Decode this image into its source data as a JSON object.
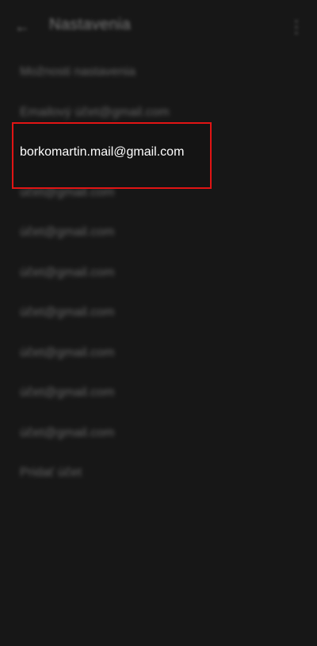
{
  "header": {
    "back_icon": "arrow-left-icon",
    "title": "Nastavenia",
    "more_icon": "more-vert-icon"
  },
  "accounts": [
    {
      "label": "Možnosti nastavenia"
    },
    {
      "label": "Emailový účet@gmail.com"
    },
    {
      "label": "borkomartin.mail@gmail.com"
    },
    {
      "label": "účet@gmail.com"
    },
    {
      "label": "účet@gmail.com"
    },
    {
      "label": "účet@gmail.com"
    },
    {
      "label": "účet@gmail.com"
    },
    {
      "label": "účet@gmail.com"
    },
    {
      "label": "účet@gmail.com"
    },
    {
      "label": "účet@gmail.com"
    },
    {
      "label": "Pridať účet"
    }
  ],
  "selected": {
    "label": "borkomartin.mail@gmail.com",
    "highlight_color": "#e11414"
  }
}
